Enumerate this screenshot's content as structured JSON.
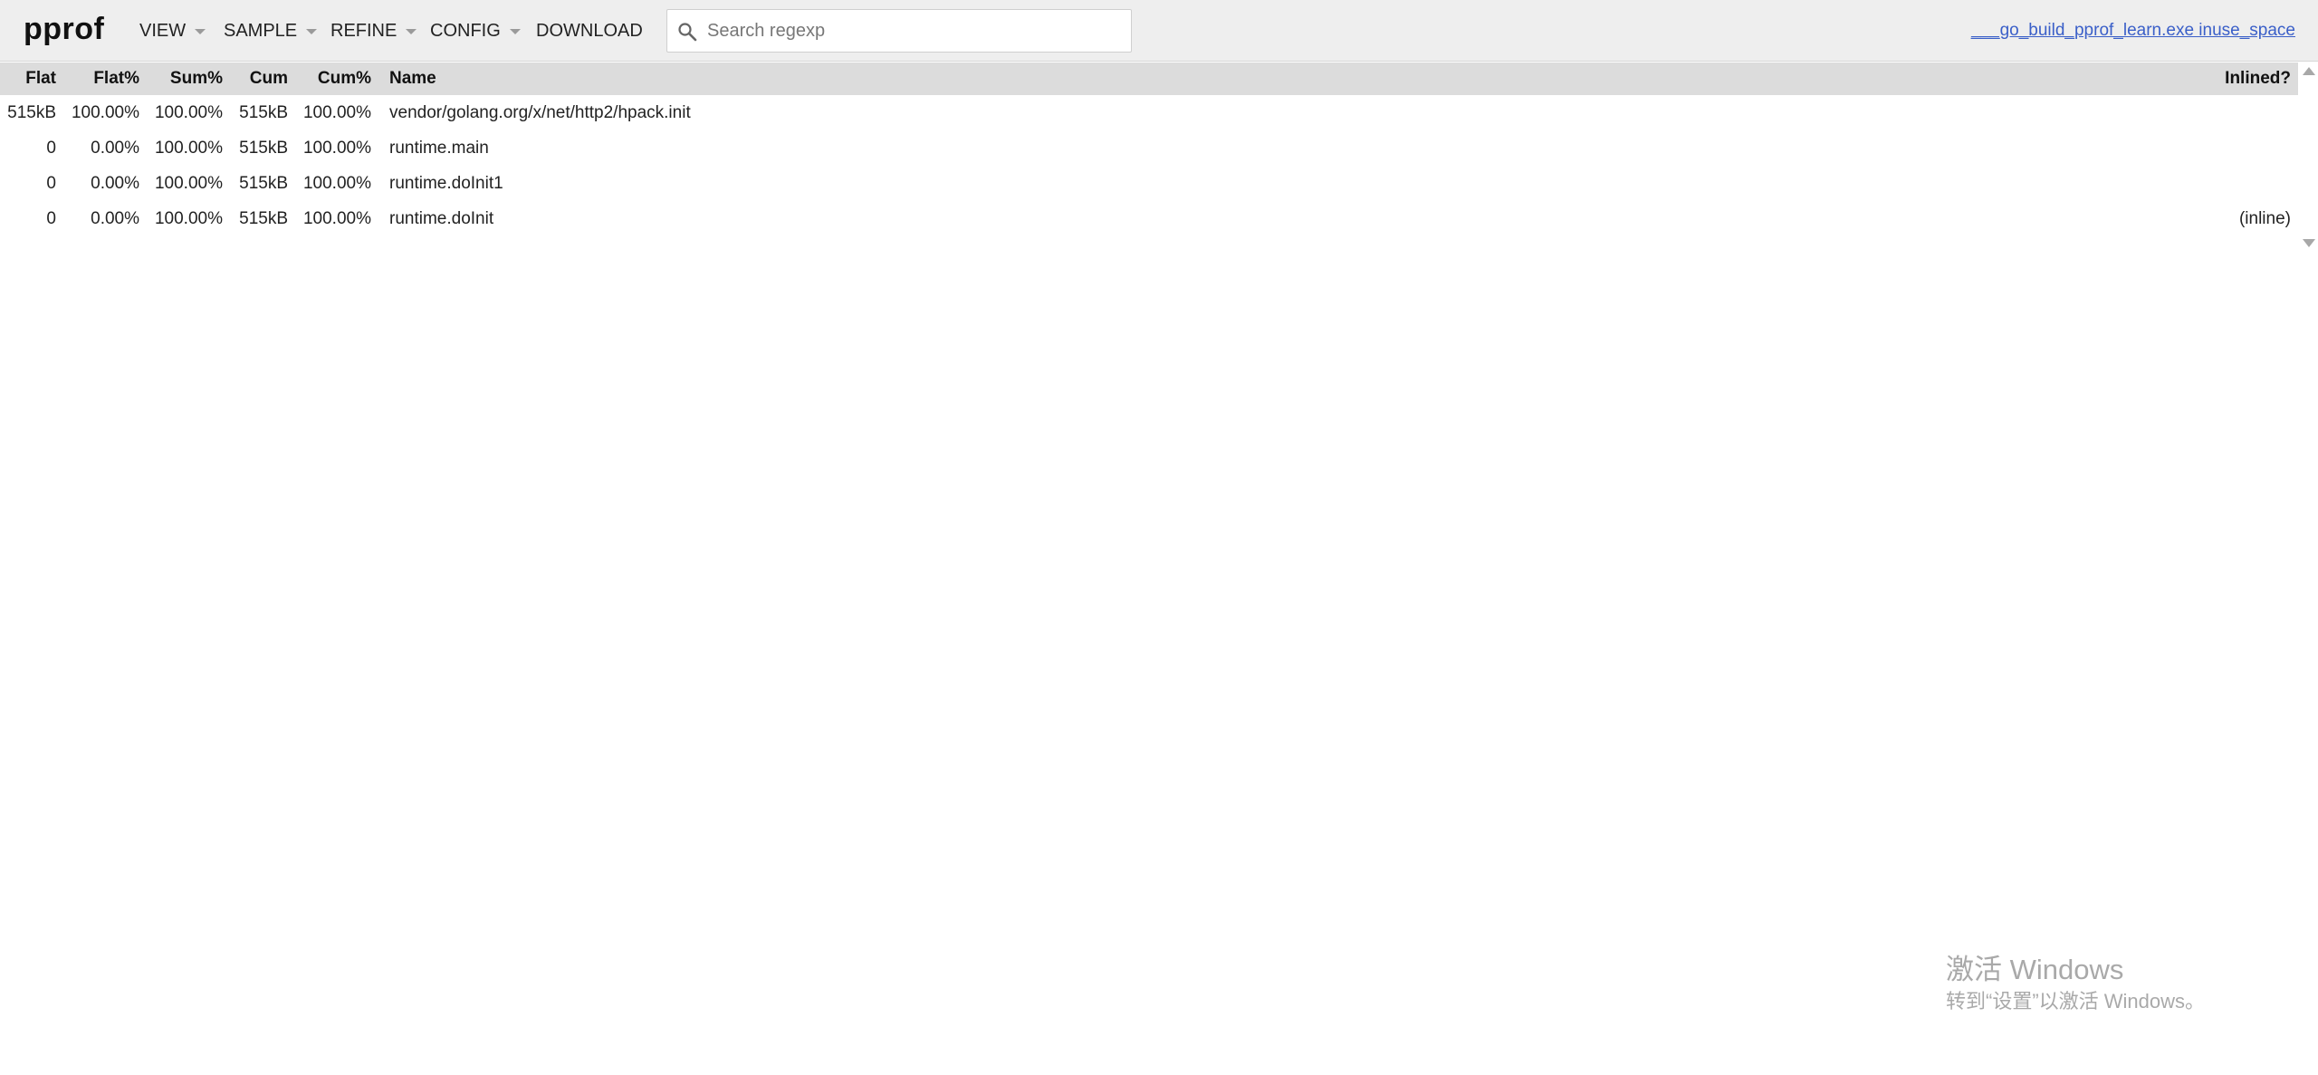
{
  "header": {
    "logo": "pprof",
    "menus": [
      {
        "label": "VIEW",
        "has_dropdown": true
      },
      {
        "label": "SAMPLE",
        "has_dropdown": true
      },
      {
        "label": "REFINE",
        "has_dropdown": true
      },
      {
        "label": "CONFIG",
        "has_dropdown": true
      },
      {
        "label": "DOWNLOAD",
        "has_dropdown": false
      }
    ],
    "search": {
      "placeholder": "Search regexp",
      "value": "",
      "icon": "search-icon"
    },
    "profile_link": "___go_build_pprof_learn.exe inuse_space"
  },
  "table": {
    "columns": [
      "Flat",
      "Flat%",
      "Sum%",
      "Cum",
      "Cum%",
      "Name",
      "Inlined?"
    ],
    "rows": [
      {
        "flat": "515kB",
        "flat_pct": "100.00%",
        "sum_pct": "100.00%",
        "cum": "515kB",
        "cum_pct": "100.00%",
        "name": "vendor/golang.org/x/net/http2/hpack.init",
        "inlined": ""
      },
      {
        "flat": "0",
        "flat_pct": "0.00%",
        "sum_pct": "100.00%",
        "cum": "515kB",
        "cum_pct": "100.00%",
        "name": "runtime.main",
        "inlined": ""
      },
      {
        "flat": "0",
        "flat_pct": "0.00%",
        "sum_pct": "100.00%",
        "cum": "515kB",
        "cum_pct": "100.00%",
        "name": "runtime.doInit1",
        "inlined": ""
      },
      {
        "flat": "0",
        "flat_pct": "0.00%",
        "sum_pct": "100.00%",
        "cum": "515kB",
        "cum_pct": "100.00%",
        "name": "runtime.doInit",
        "inlined": "(inline)"
      }
    ]
  },
  "watermark": {
    "title": "激活 Windows",
    "subtitle": "转到“设置”以激活 Windows。"
  },
  "colors": {
    "header_bg": "#eeeeee",
    "table_header_bg": "#dcdcdc",
    "link": "#3a5fc8",
    "watermark": "#a9a9a9"
  }
}
